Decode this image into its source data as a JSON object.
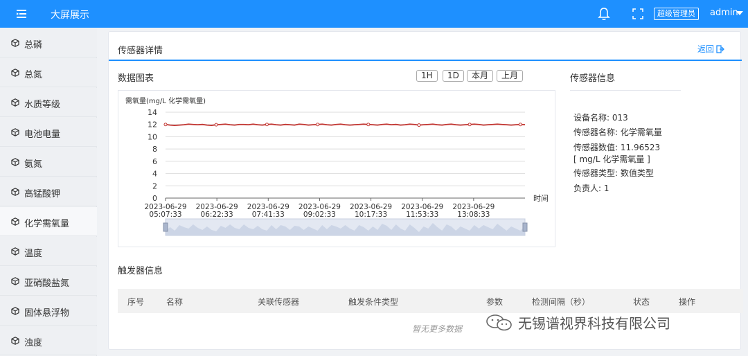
{
  "header": {
    "app_title": "大屏展示",
    "role_badge": "超级管理员",
    "username": "admin",
    "menu_icon": "menu-fold-icon",
    "bell_icon": "bell-icon",
    "fullscreen_icon": "fullscreen-icon",
    "bg_color": "#1e90ff"
  },
  "sidebar": {
    "items": [
      {
        "label": "总磷",
        "icon": "cube-icon",
        "active": false
      },
      {
        "label": "总氮",
        "icon": "cube-icon",
        "active": false
      },
      {
        "label": "水质等级",
        "icon": "cube-icon",
        "active": false
      },
      {
        "label": "电池电量",
        "icon": "cube-icon",
        "active": false
      },
      {
        "label": "氨氮",
        "icon": "cube-icon",
        "active": false
      },
      {
        "label": "高锰酸钾",
        "icon": "cube-icon",
        "active": false
      },
      {
        "label": "化学需氧量",
        "icon": "cube-icon",
        "active": true
      },
      {
        "label": "温度",
        "icon": "cube-icon",
        "active": false
      },
      {
        "label": "亚硝酸盐氮",
        "icon": "cube-icon",
        "active": false
      },
      {
        "label": "固体悬浮物",
        "icon": "cube-icon",
        "active": false
      },
      {
        "label": "浊度",
        "icon": "cube-icon",
        "active": false
      }
    ]
  },
  "detail": {
    "title": "传感器详情",
    "back_label": "返回",
    "chart_section_title": "数据图表",
    "range_buttons": [
      "1H",
      "1D",
      "本月",
      "上月"
    ],
    "info_section_title": "传感器信息",
    "info": {
      "device_name": "设备名称:  013",
      "sensor_name": "传感器名称:  化学需氧量",
      "sensor_value": "传感器数值:  11.96523",
      "sensor_unit": "[ mg/L 化学需氧量 ]",
      "sensor_type": "传感器类型:  数值类型",
      "owner": "负责人:  1"
    },
    "trigger_section_title": "触发器信息",
    "table_headers": [
      "序号",
      "名称",
      "关联传感器",
      "触发条件类型",
      "参数",
      "检测间隔（秒）",
      "状态",
      "操作"
    ],
    "empty_text": "暂无更多数据"
  },
  "chart_data": {
    "type": "line",
    "ylabel": "需氧量(mg/L 化学需氧量)",
    "xlabel": "时间",
    "ylim": [
      0,
      14
    ],
    "yticks": [
      0,
      2,
      4,
      6,
      8,
      10,
      12,
      14
    ],
    "xticks": [
      [
        "2023-06-29",
        "05:07:33"
      ],
      [
        "2023-06-29",
        "06:22:33"
      ],
      [
        "2023-06-29",
        "07:41:33"
      ],
      [
        "2023-06-29",
        "09:02:33"
      ],
      [
        "2023-06-29",
        "10:17:33"
      ],
      [
        "2023-06-29",
        "11:53:33"
      ],
      [
        "2023-06-29",
        "13:08:33"
      ]
    ],
    "series": [
      {
        "color": "#c23531",
        "values": [
          12.0,
          11.9,
          11.85,
          11.9,
          11.95,
          12.05,
          12.0,
          11.95,
          12.0,
          11.9,
          11.85,
          11.95,
          12.0,
          12.05,
          11.95,
          11.9,
          12.0,
          12.0,
          11.95,
          12.05,
          11.95,
          11.9,
          12.0,
          12.05,
          11.95,
          11.9,
          12.0,
          11.95,
          11.9,
          12.05,
          12.0,
          11.9,
          11.95,
          12.0,
          12.05,
          11.95,
          11.9,
          12.0,
          12.05,
          11.95,
          11.9,
          11.95,
          12.0,
          12.05,
          12.0,
          11.95,
          11.9,
          12.0,
          12.05,
          11.95,
          12.0,
          11.9,
          11.95,
          12.05,
          12.0,
          11.9,
          11.95,
          12.0,
          12.05,
          11.95,
          11.9,
          12.0,
          12.05,
          11.95,
          11.9,
          11.95,
          12.0,
          12.05,
          12.0,
          11.9,
          11.95,
          12.0,
          12.05,
          12.0,
          11.95,
          11.9,
          11.95,
          12.0,
          11.97
        ]
      }
    ],
    "grid": true,
    "data_zoom": true
  },
  "watermark": {
    "text": "无锡谱视界科技有限公司",
    "icon": "wechat-icon"
  }
}
